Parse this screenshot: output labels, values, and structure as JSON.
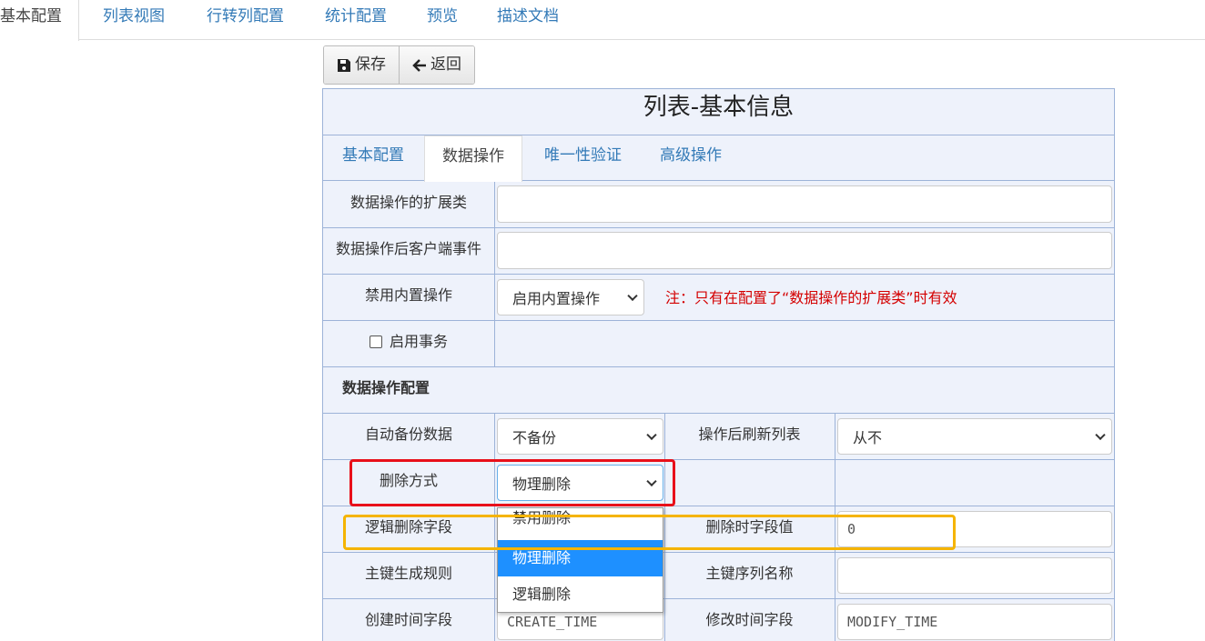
{
  "top_tabs": [
    "基本配置",
    "列表视图",
    "行转列配置",
    "统计配置",
    "预览",
    "描述文档"
  ],
  "toolbar": {
    "save_label": "保存",
    "back_label": "返回"
  },
  "panel": {
    "title": "列表-基本信息",
    "tabs": [
      "基本配置",
      "数据操作",
      "唯一性验证",
      "高级操作"
    ],
    "active_tab": "数据操作"
  },
  "form": {
    "ext_class_label": "数据操作的扩展类",
    "ext_class_value": "",
    "client_event_label": "数据操作后客户端事件",
    "client_event_value": "",
    "disable_builtin_label": "禁用内置操作",
    "disable_builtin_value": "启用内置操作",
    "note": "注：只有在配置了“数据操作的扩展类”时有效",
    "transaction_label": "启用事务",
    "section_title": "数据操作配置",
    "auto_backup_label": "自动备份数据",
    "auto_backup_value": "不备份",
    "refresh_label": "操作后刷新列表",
    "refresh_value": "从不",
    "delete_mode_label": "删除方式",
    "delete_mode_value": "物理删除",
    "logic_field_label": "逻辑删除字段",
    "delete_value_label": "删除时字段值",
    "delete_value_value": "0",
    "pk_rule_label": "主键生成规则",
    "pk_seq_label": "主键序列名称",
    "pk_seq_value": "",
    "create_time_label": "创建时间字段",
    "create_time_value": "CREATE_TIME",
    "modify_time_label": "修改时间字段",
    "modify_time_value": "MODIFY_TIME"
  },
  "dropdown_options": [
    "禁用删除",
    "物理删除",
    "逻辑删除"
  ],
  "colors": {
    "link": "#337ab7",
    "note": "#d40000",
    "selected": "#1e90ff",
    "highlight_red": "#e8101a",
    "highlight_orange": "#f5b400"
  }
}
